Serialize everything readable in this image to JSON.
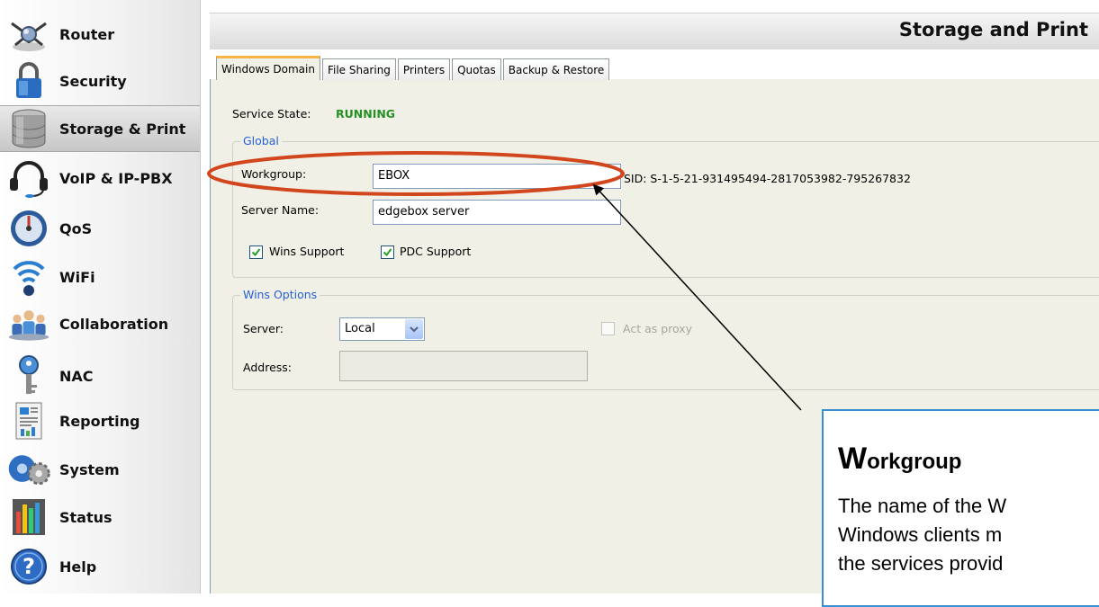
{
  "sidebar": {
    "items": [
      {
        "label": "Router",
        "icon": "router-icon"
      },
      {
        "label": "Security",
        "icon": "padlock-icon"
      },
      {
        "label": "Storage & Print",
        "icon": "database-icon",
        "active": true
      },
      {
        "label": "VoIP & IP-PBX",
        "icon": "headset-icon"
      },
      {
        "label": "QoS",
        "icon": "speedometer-icon"
      },
      {
        "label": "WiFi",
        "icon": "wifi-icon"
      },
      {
        "label": "Collaboration",
        "icon": "people-icon"
      },
      {
        "label": "NAC",
        "icon": "keys-icon"
      },
      {
        "label": "Reporting",
        "icon": "report-icon"
      },
      {
        "label": "System",
        "icon": "gears-icon"
      },
      {
        "label": "Status",
        "icon": "bars-icon"
      },
      {
        "label": "Help",
        "icon": "help-icon"
      }
    ]
  },
  "header": {
    "title": "Storage and Print"
  },
  "tabs": [
    {
      "label": "Windows Domain",
      "active": true
    },
    {
      "label": "File Sharing"
    },
    {
      "label": "Printers"
    },
    {
      "label": "Quotas"
    },
    {
      "label": "Backup & Restore"
    }
  ],
  "service": {
    "label": "Service State:",
    "value": "RUNNING"
  },
  "global": {
    "title": "Global",
    "workgroup_label": "Workgroup:",
    "workgroup_value": "EBOX",
    "sid_text": "SID: S-1-5-21-931495494-2817053982-795267832",
    "server_name_label": "Server Name:",
    "server_name_value": "edgebox server",
    "wins_support_label": "Wins Support",
    "wins_support_checked": true,
    "pdc_support_label": "PDC Support",
    "pdc_support_checked": true
  },
  "wins_options": {
    "title": "Wins Options",
    "server_label": "Server:",
    "server_value": "Local",
    "proxy_label": "Act as proxy",
    "proxy_checked": false,
    "address_label": "Address:",
    "address_value": ""
  },
  "callout": {
    "title_first": "W",
    "title_rest": "orkgroup",
    "line1": "The name of the W",
    "line2": "Windows clients m",
    "line3": "the services provid"
  },
  "colors": {
    "running": "#259025",
    "group_title": "#245edb",
    "annotation_ellipse": "#d2461e",
    "callout_border": "#3a8fd1",
    "active_tab": "#f7b548"
  }
}
